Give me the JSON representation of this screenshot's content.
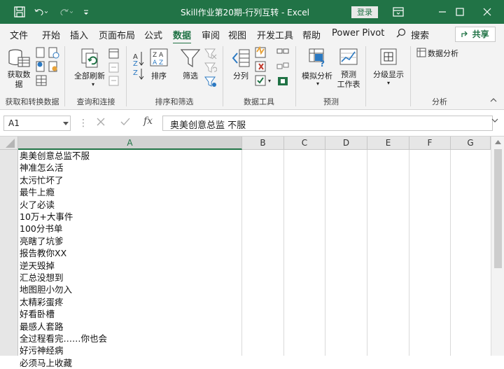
{
  "titlebar": {
    "title": "Skill作业第20期-行列互转 - Excel",
    "login": "登录"
  },
  "menu": {
    "tabs": [
      "文件",
      "开始",
      "插入",
      "页面布局",
      "公式",
      "数据",
      "审阅",
      "视图",
      "开发工具",
      "帮助",
      "Power Pivot"
    ],
    "active_tab": "数据",
    "search": "搜索",
    "share": "共享"
  },
  "ribbon": {
    "get_data": "获取数\n据",
    "refresh_all": "全部刷新",
    "sort": "排序",
    "filter": "筛选",
    "split": "分列",
    "what_if": "模拟分析",
    "forecast_sheet": "预测\n工作表",
    "outline": "分级显示",
    "data_analysis": "数据分析",
    "groups": {
      "get_transform": "获取和转换数据",
      "queries": "查询和连接",
      "sort_filter": "排序和筛选",
      "data_tools": "数据工具",
      "forecast": "预测",
      "analysis": "分析"
    }
  },
  "formula_bar": {
    "name_box": "A1",
    "fx": "fx",
    "value": "奥美创意总监  不服"
  },
  "columns": [
    "A",
    "B",
    "C",
    "D",
    "E",
    "F",
    "G"
  ],
  "cells": [
    "奥美创意总监不服",
    "神准怎么活",
    "太污忙坏了",
    "最牛上瘾",
    "火了必读",
    "10万+大事件",
    "100分书单",
    "亮瞎了坑爹",
    "报告教你XX",
    "逆天毁掉",
    "汇总没想到",
    "地图胆小勿入",
    "太精彩蛋疼",
    "好看卧槽",
    "最感人套路",
    "全过程看完……你也会",
    "好污神经病",
    "必须马上收藏"
  ],
  "colors": {
    "brand": "#217346",
    "ribbon_bg": "#f3f3f3",
    "header_bg": "#e6e6e6"
  }
}
